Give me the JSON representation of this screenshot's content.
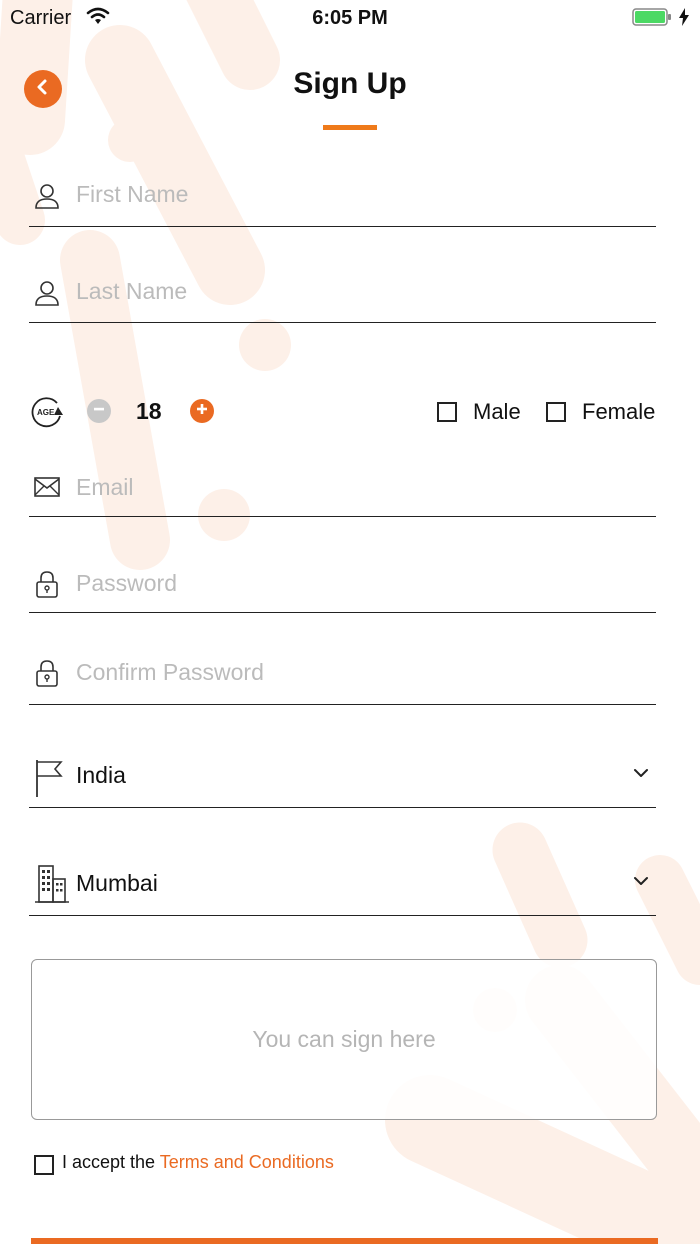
{
  "status_bar": {
    "carrier": "Carrier",
    "time": "6:05 PM"
  },
  "header": {
    "title": "Sign Up"
  },
  "form": {
    "first_name_placeholder": "First Name",
    "last_name_placeholder": "Last Name",
    "age_badge": "AGE",
    "age_value": "18",
    "male_label": "Male",
    "female_label": "Female",
    "email_placeholder": "Email",
    "password_placeholder": "Password",
    "confirm_password_placeholder": "Confirm Password",
    "country_value": "India",
    "city_value": "Mumbai",
    "signature_hint": "You can sign here",
    "terms_prefix": "I accept the",
    "terms_link": "Terms and Conditions"
  },
  "icons": {
    "back": "chevron-left-icon",
    "person": "user-icon",
    "age": "age-icon",
    "minus": "minus-circle-icon",
    "plus": "plus-circle-icon",
    "email": "envelope-icon",
    "lock": "lock-icon",
    "flag": "flag-icon",
    "building": "building-icon",
    "dropdown": "chevron-down-icon"
  },
  "colors": {
    "accent": "#ea6a22",
    "underline": "#222222",
    "background_shape": "#fdf1ea"
  }
}
